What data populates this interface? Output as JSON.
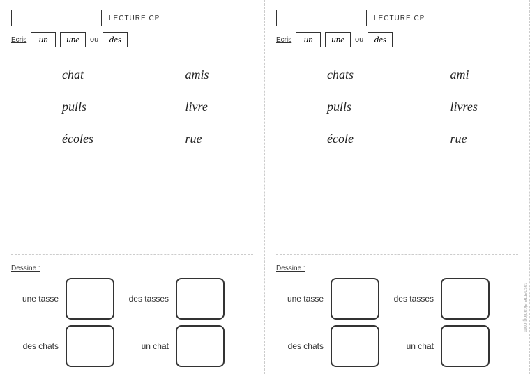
{
  "left": {
    "title": "LECTURE CP",
    "ecris_label": "Ecris",
    "ecris_words": [
      "un",
      "une",
      "ou",
      "des"
    ],
    "words": [
      [
        "chat",
        "amis"
      ],
      [
        "pulls",
        "livre"
      ],
      [
        "écoles",
        "rue"
      ]
    ],
    "dessine_label": "Dessine :",
    "dessine_rows": [
      [
        {
          "label": "une tasse"
        },
        {
          "label": "des tasses"
        }
      ],
      [
        {
          "label": "des chats"
        },
        {
          "label": "un chat"
        }
      ]
    ]
  },
  "right": {
    "title": "LECTURE CP",
    "ecris_label": "Ecris",
    "ecris_words": [
      "un",
      "une",
      "ou",
      "des"
    ],
    "words": [
      [
        "chats",
        "ami"
      ],
      [
        "pulls",
        "livres"
      ],
      [
        "école",
        "rue"
      ]
    ],
    "dessine_label": "Dessine :",
    "dessine_rows": [
      [
        {
          "label": "une tasse"
        },
        {
          "label": "des tasses"
        }
      ],
      [
        {
          "label": "des chats"
        },
        {
          "label": "un chat"
        }
      ]
    ]
  },
  "watermark": "rasbertte.eklablog.com"
}
